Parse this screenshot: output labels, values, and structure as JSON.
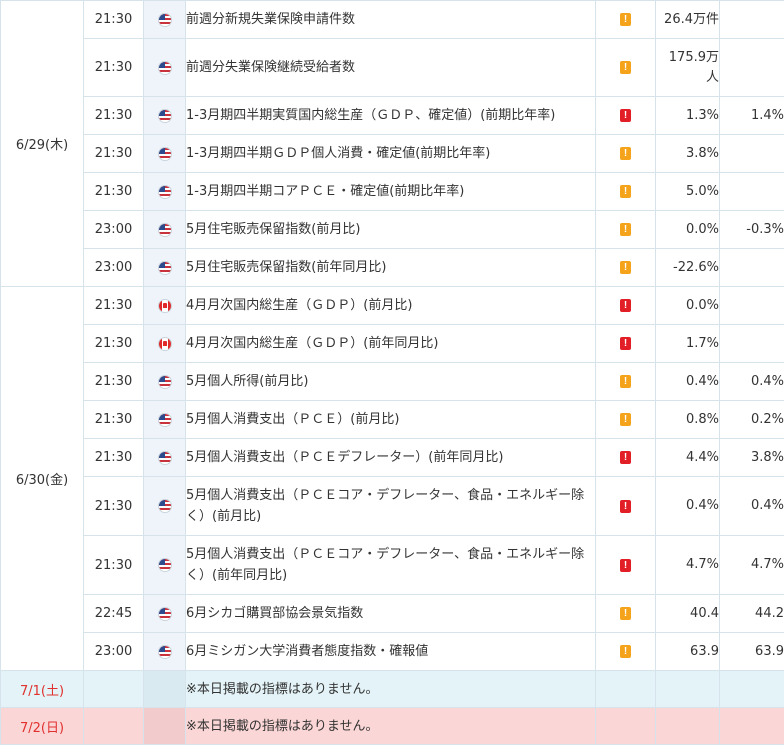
{
  "colors": {
    "importance_mid": "#f5a31a",
    "importance_high": "#e21f26",
    "weekend_text": "#e0312f"
  },
  "days": [
    {
      "date": "6/29(木)",
      "rows": [
        {
          "time": "21:30",
          "flag": "us-flag-icon",
          "name": "前週分新規失業保険申請件数",
          "importance": "mid",
          "prev": "26.4万件",
          "forecast": ""
        },
        {
          "time": "21:30",
          "flag": "us-flag-icon",
          "name": "前週分失業保険継続受給者数",
          "importance": "mid",
          "prev": "175.9万人",
          "forecast": ""
        },
        {
          "time": "21:30",
          "flag": "us-flag-icon",
          "name": "1-3月期四半期実質国内総生産（ＧＤＰ、確定値）(前期比年率)",
          "importance": "high",
          "prev": "1.3%",
          "forecast": "1.4%"
        },
        {
          "time": "21:30",
          "flag": "us-flag-icon",
          "name": "1-3月期四半期ＧＤＰ個人消費・確定値(前期比年率)",
          "importance": "mid",
          "prev": "3.8%",
          "forecast": ""
        },
        {
          "time": "21:30",
          "flag": "us-flag-icon",
          "name": "1-3月期四半期コアＰＣＥ・確定値(前期比年率)",
          "importance": "mid",
          "prev": "5.0%",
          "forecast": ""
        },
        {
          "time": "23:00",
          "flag": "us-flag-icon",
          "name": "5月住宅販売保留指数(前月比)",
          "importance": "mid",
          "prev": "0.0%",
          "forecast": "-0.3%"
        },
        {
          "time": "23:00",
          "flag": "us-flag-icon",
          "name": "5月住宅販売保留指数(前年同月比)",
          "importance": "mid",
          "prev": "-22.6%",
          "forecast": ""
        }
      ]
    },
    {
      "date": "6/30(金)",
      "rows": [
        {
          "time": "21:30",
          "flag": "ca-flag-icon",
          "name": "4月月次国内総生産（ＧＤＰ）(前月比)",
          "importance": "high",
          "prev": "0.0%",
          "forecast": ""
        },
        {
          "time": "21:30",
          "flag": "ca-flag-icon",
          "name": "4月月次国内総生産（ＧＤＰ）(前年同月比)",
          "importance": "high",
          "prev": "1.7%",
          "forecast": ""
        },
        {
          "time": "21:30",
          "flag": "us-flag-icon",
          "name": "5月個人所得(前月比)",
          "importance": "mid",
          "prev": "0.4%",
          "forecast": "0.4%"
        },
        {
          "time": "21:30",
          "flag": "us-flag-icon",
          "name": "5月個人消費支出（ＰＣＥ）(前月比)",
          "importance": "mid",
          "prev": "0.8%",
          "forecast": "0.2%"
        },
        {
          "time": "21:30",
          "flag": "us-flag-icon",
          "name": "5月個人消費支出（ＰＣＥデフレーター）(前年同月比)",
          "importance": "high",
          "prev": "4.4%",
          "forecast": "3.8%"
        },
        {
          "time": "21:30",
          "flag": "us-flag-icon",
          "name": "5月個人消費支出（ＰＣＥコア・デフレーター、食品・エネルギー除く）(前月比)",
          "importance": "high",
          "prev": "0.4%",
          "forecast": "0.4%"
        },
        {
          "time": "21:30",
          "flag": "us-flag-icon",
          "name": "5月個人消費支出（ＰＣＥコア・デフレーター、食品・エネルギー除く）(前年同月比)",
          "importance": "high",
          "prev": "4.7%",
          "forecast": "4.7%"
        },
        {
          "time": "22:45",
          "flag": "us-flag-icon",
          "name": "6月シカゴ購買部協会景気指数",
          "importance": "mid",
          "prev": "40.4",
          "forecast": "44.2"
        },
        {
          "time": "23:00",
          "flag": "us-flag-icon",
          "name": "6月ミシガン大学消費者態度指数・確報値",
          "importance": "mid",
          "prev": "63.9",
          "forecast": "63.9"
        }
      ]
    }
  ],
  "weekend": [
    {
      "date": "7/1(土)",
      "note": "※本日掲載の指標はありません。",
      "kind": "sat"
    },
    {
      "date": "7/2(日)",
      "note": "※本日掲載の指標はありません。",
      "kind": "sun"
    }
  ]
}
